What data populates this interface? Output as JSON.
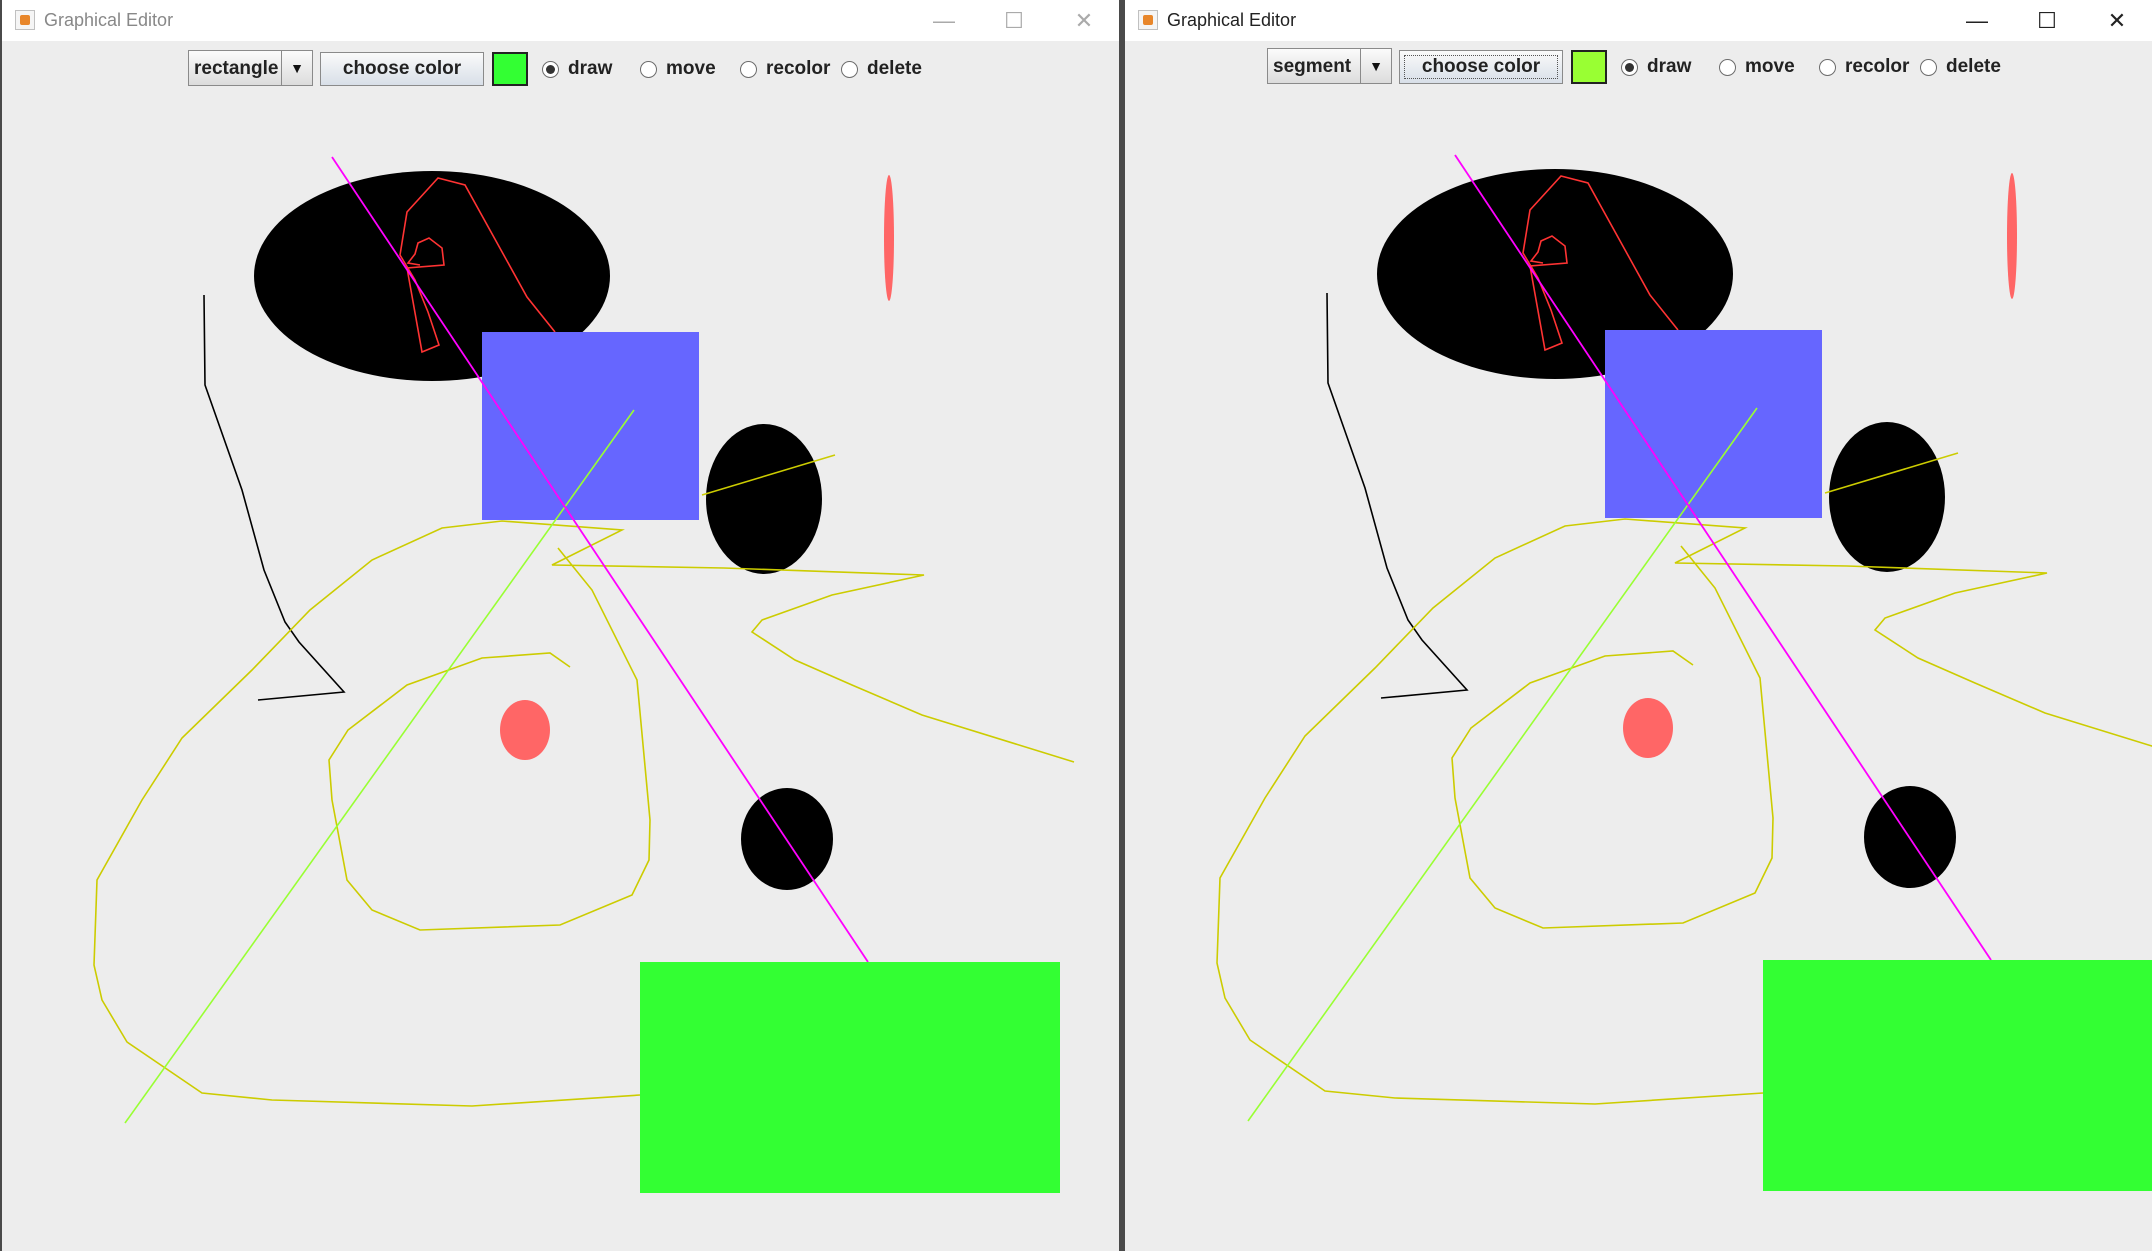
{
  "left_window": {
    "title": "Graphical Editor",
    "controls": {
      "minimize": "—",
      "maximize": "☐",
      "close": "✕"
    },
    "shape_select": {
      "value": "rectangle"
    },
    "choose_color_label": "choose color",
    "current_color": "#33ff33",
    "modes": [
      {
        "label": "draw",
        "selected": true
      },
      {
        "label": "move",
        "selected": false
      },
      {
        "label": "recolor",
        "selected": false
      },
      {
        "label": "delete",
        "selected": false
      }
    ]
  },
  "right_window": {
    "title": "Graphical Editor",
    "controls": {
      "minimize": "—",
      "maximize": "☐",
      "close": "✕"
    },
    "shape_select": {
      "value": "segment"
    },
    "choose_color_label": "choose color",
    "current_color": "#99ff33",
    "modes": [
      {
        "label": "draw",
        "selected": true
      },
      {
        "label": "move",
        "selected": false
      },
      {
        "label": "recolor",
        "selected": false
      },
      {
        "label": "delete",
        "selected": false
      }
    ]
  },
  "colors": {
    "canvas": "#ededed",
    "black": "#000000",
    "blue_rect": "#6666ff",
    "green_rect": "#33ff33",
    "salmon": "#ff6666",
    "magenta": "#ff00ff",
    "lime": "#99ff33",
    "yellow": "#cccc00",
    "red": "#ff3333"
  }
}
